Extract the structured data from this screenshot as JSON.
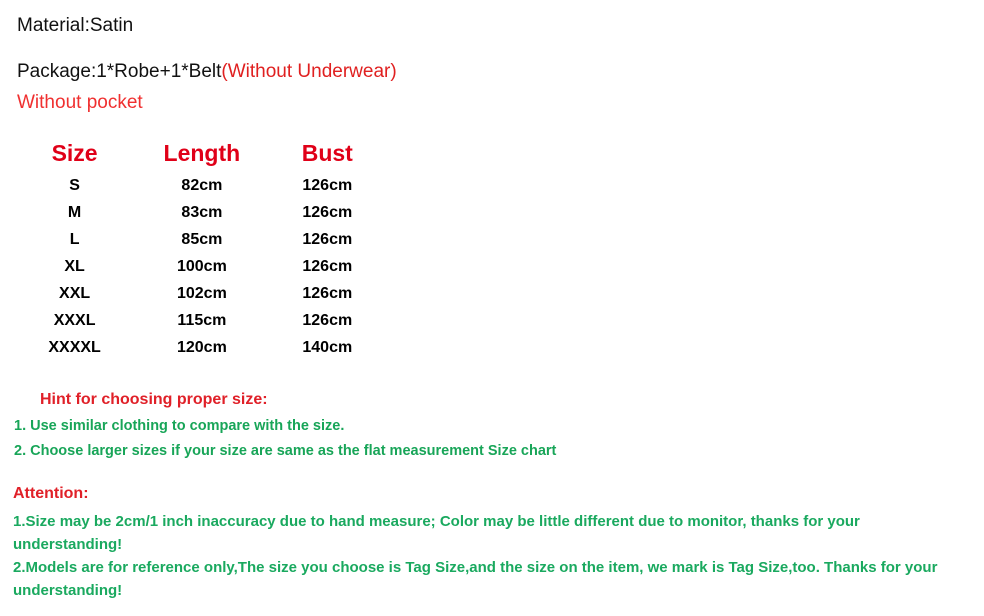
{
  "colors": {
    "red": "#e02020",
    "red_heading": "#e00018",
    "green": "#18a558",
    "black": "#111111",
    "background": "#ffffff"
  },
  "info": {
    "material": "Material:Satin",
    "package_black": "Package:1*Robe+1*Belt",
    "package_red": "(Without Underwear)",
    "without_pocket": "Without pocket"
  },
  "size_chart": {
    "headers": [
      "Size",
      "Length",
      "Bust"
    ],
    "rows": [
      [
        "S",
        "82cm",
        "126cm"
      ],
      [
        "M",
        "83cm",
        "126cm"
      ],
      [
        "L",
        "85cm",
        "126cm"
      ],
      [
        "XL",
        "100cm",
        "126cm"
      ],
      [
        "XXL",
        "102cm",
        "126cm"
      ],
      [
        "XXXL",
        "115cm",
        "126cm"
      ],
      [
        "XXXXL",
        "120cm",
        "140cm"
      ]
    ]
  },
  "hint": {
    "title": "Hint for choosing proper size:",
    "lines": [
      "1. Use similar clothing to compare with the size.",
      "2. Choose larger sizes if your size are same as the flat measurement Size chart"
    ]
  },
  "attention": {
    "title": "Attention:",
    "lines": [
      "1.Size may be 2cm/1 inch inaccuracy due to hand measure; Color may be little different   due to monitor, thanks for your understanding!",
      "2.Models are for reference only,The size you choose is Tag Size,and the size on the item,  we mark is Tag Size,too. Thanks for your understanding!"
    ]
  }
}
